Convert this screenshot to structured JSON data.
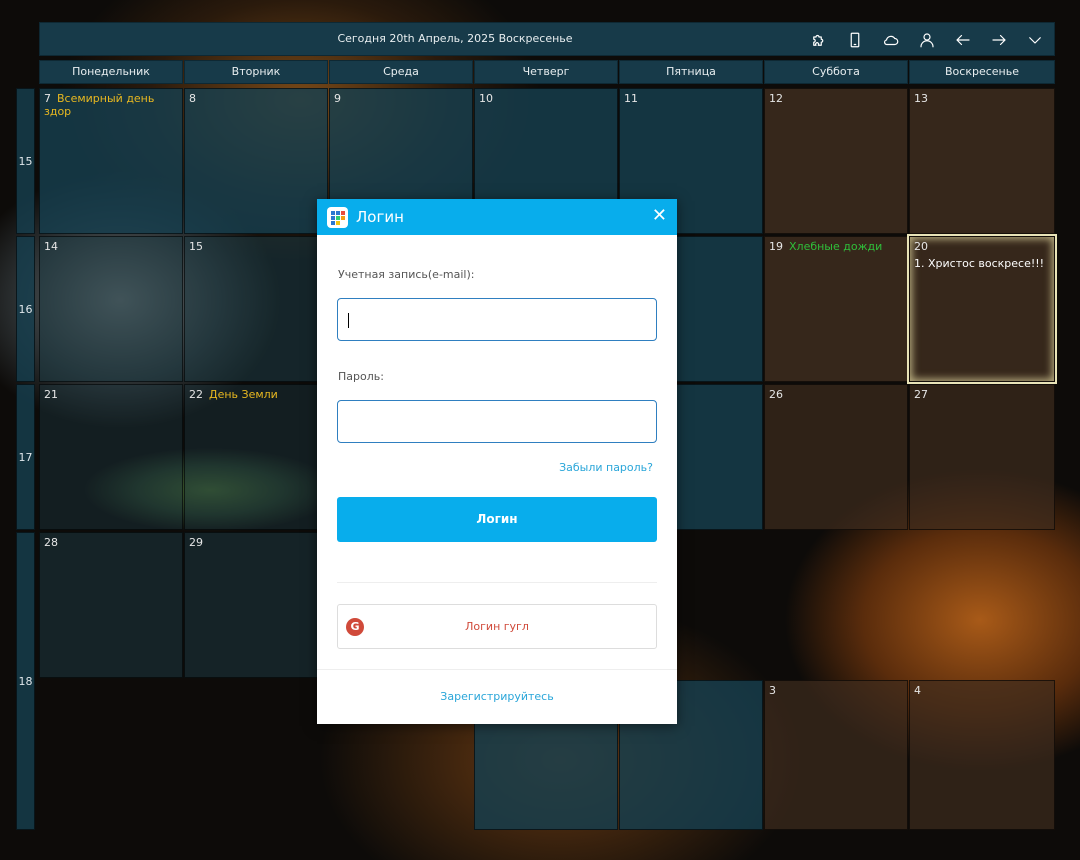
{
  "header": {
    "title": "Сегодня 20th Апрель, 2025 Воскресенье",
    "icons": [
      "puzzle-icon",
      "tablet-icon",
      "cloud-icon",
      "user-icon",
      "arrow-left-icon",
      "arrow-right-icon",
      "chevron-down-icon"
    ]
  },
  "weekdays": [
    "Понедельник",
    "Вторник",
    "Среда",
    "Четверг",
    "Пятница",
    "Суббота",
    "Воскресенье"
  ],
  "weeks": [
    "15",
    "16",
    "17",
    "18"
  ],
  "days": {
    "d7": "7",
    "d7_event": "Всемирный день здор",
    "d8": "8",
    "d9": "9",
    "d10": "10",
    "d11": "11",
    "d12": "12",
    "d13": "13",
    "d14": "14",
    "d15": "15",
    "d19": "19",
    "d19_event": "Хлебные дожди",
    "d20": "20",
    "d20_event": "1. Христос воскресе!!!",
    "d21": "21",
    "d22": "22",
    "d22_event": "День Земли",
    "d26": "26",
    "d27": "27",
    "d28": "28",
    "d29": "29",
    "d3": "3",
    "d4": "4"
  },
  "colors": {
    "holiday": "#e8b820",
    "folk": "#2fbf3a",
    "accent": "#08adec"
  },
  "dialog": {
    "title": "Логин",
    "email_label": "Учетная запись(e-mail):",
    "email_value": "",
    "password_label": "Пароль:",
    "password_value": "",
    "forgot": "Забыли пароль?",
    "login_button": "Логин",
    "google_button": "Логин гугл",
    "google_letter": "G",
    "register": "Зарегистрируйтесь"
  }
}
